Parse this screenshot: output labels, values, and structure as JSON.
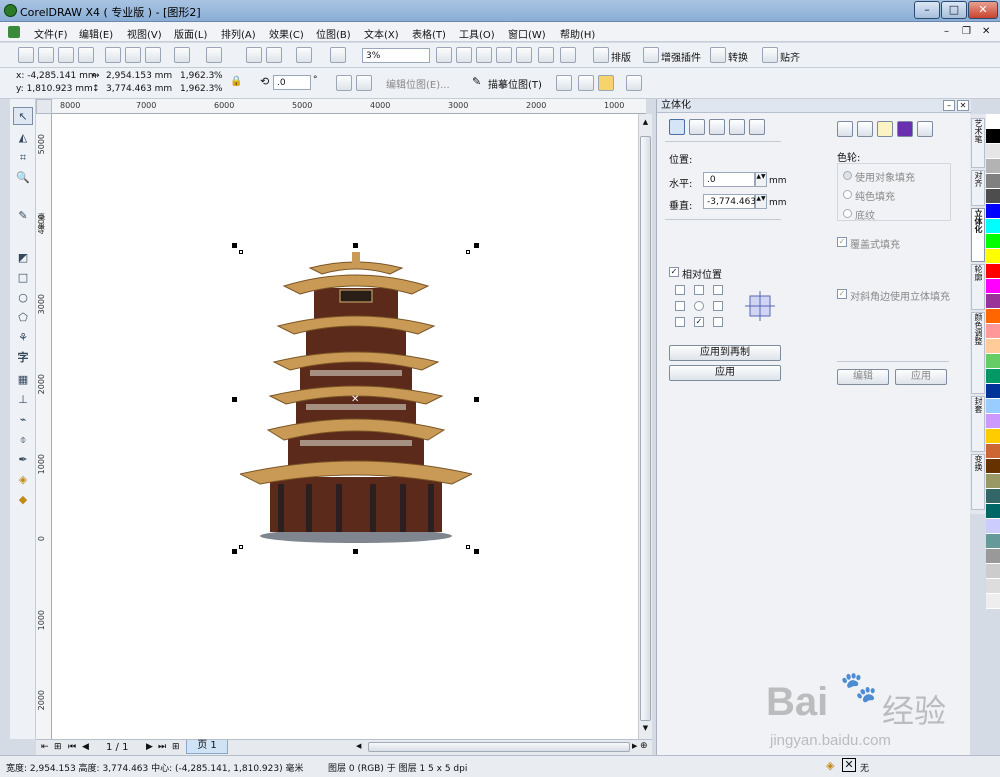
{
  "window": {
    "title": "CorelDRAW X4 ( 专业版 ) - [图形2]"
  },
  "menu": [
    "文件(F)",
    "编辑(E)",
    "视图(V)",
    "版面(L)",
    "排列(A)",
    "效果(C)",
    "位图(B)",
    "文本(X)",
    "表格(T)",
    "工具(O)",
    "窗口(W)",
    "帮助(H)"
  ],
  "toolbar": {
    "zoom": "3%",
    "imposition": "排版",
    "plugins": "增强插件",
    "convert": "转换",
    "align": "贴齐"
  },
  "propbar": {
    "x": "x: -4,285.141 mm",
    "y": "y: 1,810.923 mm",
    "width": "2,954.153 mm",
    "height": "3,774.463 mm",
    "scale_x": "1,962.3",
    "scale_y": "1,962.3",
    "pct": "%",
    "rotation": ".0",
    "deg": "°",
    "edit_bitmap": "编辑位图(E)...",
    "trace_bitmap": "描摹位图(T)"
  },
  "ruler_h": [
    "8000",
    "7000",
    "6000",
    "5000",
    "4000",
    "3000",
    "2000",
    "1000"
  ],
  "ruler_v": [
    "5000",
    "4000",
    "3000",
    "2000",
    "1000",
    "0",
    "1000",
    "2000"
  ],
  "ruler_unit": "毫米",
  "pagebar": {
    "counter": "1 / 1",
    "page_tab": "页 1"
  },
  "status": {
    "dims": "宽度: 2,954.153 高度: 3,774.463 中心: (-4,285.141, 1,810.923) 毫米",
    "layer": "图层 0 (RGB) 于 图层 1 5 x 5 dpi",
    "fill_none": "无"
  },
  "docker": {
    "title": "立体化",
    "position_label": "位置:",
    "horizontal_label": "水平:",
    "horizontal_value": ".0",
    "vertical_label": "垂直:",
    "vertical_value": "-3,774.463",
    "unit": "mm",
    "relative_label": "相对位置",
    "apply_copy": "应用到再制",
    "apply": "应用",
    "color_wheel_label": "色轮:",
    "radio_object": "使用对象填充",
    "radio_solid": "纯色填充",
    "radio_shade": "底纹",
    "overprint": "覆盖式填充",
    "bevel_fill": "对斜角边使用立体填充",
    "edit": "编辑",
    "apply2": "应用"
  },
  "righttabs": [
    "艺术笔",
    "对齐",
    "立体化",
    "轮廓",
    "颜色调整",
    "封套",
    "变换"
  ],
  "palette_colors": [
    "#ffffff",
    "#000000",
    "#e6e6e6",
    "#b3b3b3",
    "#808080",
    "#4d4d4d",
    "#0000ff",
    "#00ffff",
    "#00ff00",
    "#ffff00",
    "#ff0000",
    "#ff00ff",
    "#993399",
    "#ff6600",
    "#ff9999",
    "#ffcc99",
    "#66cc66",
    "#009966",
    "#003399",
    "#99ccff",
    "#cc99ff",
    "#ffcc00",
    "#cc6633",
    "#663300",
    "#999966",
    "#336666",
    "#006666",
    "#ccccff",
    "#669999",
    "#999999",
    "#cccccc",
    "#dddddd",
    "#eeeeee"
  ],
  "watermark": {
    "brand": "Bai",
    "brand2": "经验",
    "url": "jingyan.baidu.com"
  }
}
